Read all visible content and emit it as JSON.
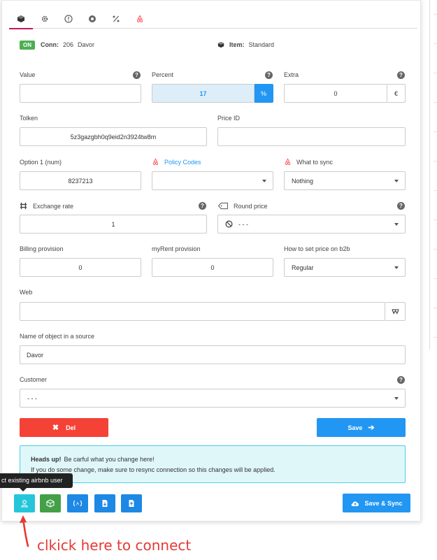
{
  "tabs": [
    {
      "icon": "cube-icon",
      "active": true
    },
    {
      "icon": "gear-icon",
      "active": false
    },
    {
      "icon": "alert-circle-icon",
      "active": false
    },
    {
      "icon": "record-icon",
      "active": false
    },
    {
      "icon": "percent-icon",
      "active": false
    },
    {
      "icon": "airbnb-icon",
      "active": false
    }
  ],
  "header": {
    "status": "ON",
    "conn_label": "Conn:",
    "conn_id": "206",
    "conn_name": "Davor",
    "item_label": "Item:",
    "item_value": "Standard"
  },
  "form": {
    "value_label": "Value",
    "value": "",
    "percent_label": "Percent",
    "percent_value": "17",
    "percent_addon": "%",
    "extra_label": "Extra",
    "extra_value": "0",
    "extra_addon": "€",
    "tolken_label": "Tolken",
    "tolken_value": "5z3gazgbh0q9eid2n3924tw8m",
    "price_id_label": "Price ID",
    "price_id_value": "",
    "option1_label": "Option 1 (num)",
    "option1_value": "8237213",
    "policy_codes_label": "Policy Codes",
    "policy_codes_value": "",
    "what_to_sync_label": "What to sync",
    "what_to_sync_value": "Nothing",
    "exchange_rate_label": "Exchange rate",
    "exchange_rate_value": "1",
    "round_price_label": "Round price",
    "round_price_value": "- - -",
    "billing_provision_label": "Billing provision",
    "billing_provision_value": "0",
    "myrent_provision_label": "myRent provision",
    "myrent_provision_value": "0",
    "b2b_label": "How to set price on b2b",
    "b2b_value": "Regular",
    "web_label": "Web",
    "web_value": "",
    "object_name_label": "Name of object in a source",
    "object_name_value": "Davor",
    "customer_label": "Customer",
    "customer_value": "- - -"
  },
  "actions": {
    "del_label": "Del",
    "save_label": "Save"
  },
  "alert": {
    "title": "Heads up!",
    "line1": "Be carful what you change here!",
    "line2": "If you do some change, make sure to resync connection so this changes will be applied."
  },
  "toolbar": {
    "tooltip": "ct existing airbnb user",
    "save_sync_label": "Save & Sync",
    "buttons": [
      {
        "icon": "user-icon",
        "color": "#26c6da"
      },
      {
        "icon": "cube-3d-icon",
        "color": "#43a047"
      },
      {
        "icon": "broadcast-icon",
        "color": "#1e88e5"
      },
      {
        "icon": "file-download-icon",
        "color": "#1e88e5"
      },
      {
        "icon": "file-upload-icon",
        "color": "#1e88e5"
      }
    ]
  },
  "annotation": {
    "text": "clkick here to connect",
    "color": "#e53935"
  },
  "colors": {
    "primary": "#2196f3",
    "danger": "#f44336",
    "success": "#4caf50",
    "info_bg": "#e0f7fa",
    "active_tab": "#c2185b"
  }
}
